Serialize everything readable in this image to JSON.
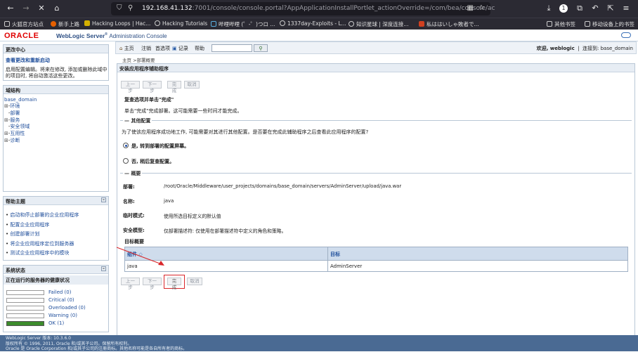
{
  "browser": {
    "url_host": "192.168.41.132",
    "url_rest": ":7001/console/console.portal?AppApplicationInstallPortlet_actionOverride=/com/bea/console/ac",
    "bookmarks": [
      "火狐官方站点",
      "新手上路",
      "Hacking Loops | Hac...",
      "Hacking Tutorials",
      "哔哩哔哩 (゜-゜)つロ ...",
      "1337day-Exploits - L...",
      "知识星球 | 深度连接...",
      "私ははいしゃ敗者で..."
    ],
    "bookmarks_right": [
      "其他书签",
      "移动设备上的书签"
    ],
    "tab_badge": "1"
  },
  "header": {
    "oracle": "ORACLE",
    "product": "WebLogic Server",
    "reg": "®",
    "subtitle": "Administration Console"
  },
  "change_center": {
    "title": "更改中心",
    "link": "查看更改和重新启动",
    "text": "启用配置编辑。将来在修改, 添加或删除此域中的项目时, 将自动激活这些更改。"
  },
  "domain_structure": {
    "title": "域结构",
    "root": "base_domain",
    "items": [
      "环境",
      "部署",
      "服务",
      "安全领域",
      "互用性",
      "诊断"
    ]
  },
  "help_topics": {
    "title": "帮助主题",
    "items": [
      "启动和停止部署的企业应用程序",
      "配置企业应用程序",
      "创建部署计划",
      "将企业应用程序定位到服务器",
      "测试企业应用程序中的模块"
    ]
  },
  "system_status": {
    "title": "系统状态",
    "subtitle": "正在运行的服务器的健康状况",
    "rows": [
      {
        "label": "Failed (0)",
        "color": "#c00000"
      },
      {
        "label": "Critical (0)",
        "color": "#e06000"
      },
      {
        "label": "Overloaded (0)",
        "color": "#e0a000"
      },
      {
        "label": "Warning (0)",
        "color": "#e0d000"
      },
      {
        "label": "OK (1)",
        "color": "#3c8c2c",
        "fill": 1.0
      }
    ]
  },
  "toolbar": {
    "home": "主页",
    "logout": "注销",
    "prefs": "首选项",
    "record": "记录",
    "help": "帮助",
    "search_btn": "Q",
    "welcome": "欢迎, weblogic",
    "connected": "连接到: base_domain"
  },
  "breadcrumb": "主页 >部署概要",
  "wizard": {
    "title": "安装应用程序辅助程序",
    "buttons": {
      "back": "上一步",
      "next": "下一步",
      "finish": "完成",
      "cancel": "取消"
    },
    "review_heading": "复查选项并单击\"完成\"",
    "review_text": "单击\"完成\"完成部署。这可能需要一些时间才能完成。",
    "other_config": "其他配置",
    "other_text": "为了使该应用程序成功地工作, 可能需要对其进行其他配置。是否要在完成此辅助程序之后查看此应用程序的配置?",
    "option_yes": "是, 转到部署的配置屏幕。",
    "option_no": "否, 稍后复查配置。",
    "summary": "概要",
    "fields": [
      {
        "label": "部署:",
        "value": "/root/Oracle/Middleware/user_projects/domains/base_domain/servers/AdminServer/upload/java.war"
      },
      {
        "label": "名称:",
        "value": "java"
      },
      {
        "label": "临时模式:",
        "value": "使用所选目标定义的默认值"
      },
      {
        "label": "安全模型:",
        "value": "仅部署描述符: 仅使用在部署描述符中定义的角色和策略。"
      }
    ],
    "target_summary": "目标概要",
    "table": {
      "headers": [
        "组件",
        "目标"
      ],
      "rows": [
        [
          "java",
          "AdminServer"
        ]
      ]
    }
  },
  "footer": {
    "line1": "WebLogic Server 版本: 10.3.6.0",
    "line2": "版权所有 © 1996, 2011, Oracle 和/或其子公司。保留所有权利。",
    "line3": "Oracle 是 Oracle Corporation 和/或其子公司的注册商标。其他名称可能是各自所有者的商标。"
  }
}
